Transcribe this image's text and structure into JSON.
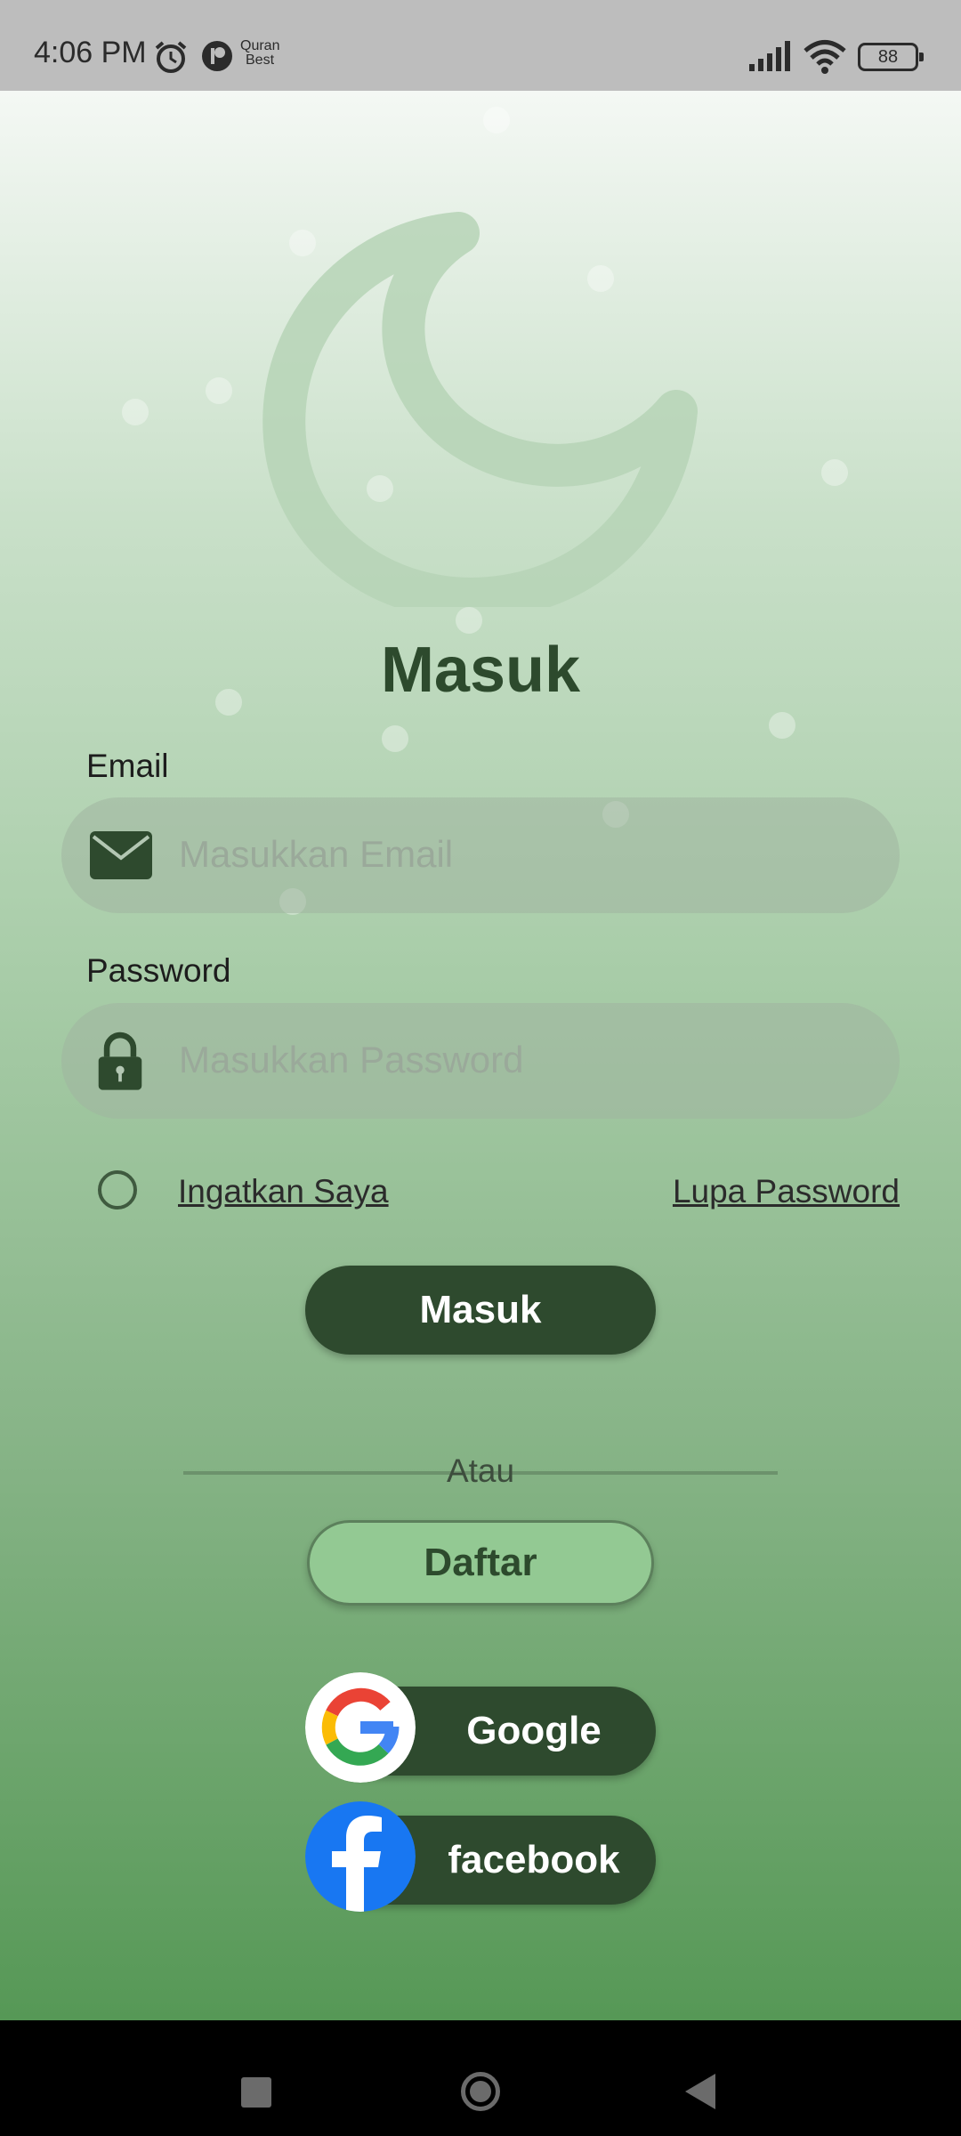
{
  "status_bar": {
    "time": "4:06 PM",
    "app_text_line1": "Quran",
    "app_text_line2": "Best",
    "battery": "88"
  },
  "login": {
    "title": "Masuk",
    "email_label": "Email",
    "email_placeholder": "Masukkan Email",
    "password_label": "Password",
    "password_placeholder": "Masukkan Password",
    "remember_label": "Ingatkan Saya",
    "forgot_label": "Lupa Password",
    "submit_label": "Masuk",
    "divider_label": "Atau",
    "register_label": "Daftar",
    "google_label": "Google",
    "facebook_label": "facebook"
  },
  "icons": {
    "email": "envelope-icon",
    "password": "lock-icon",
    "google": "google-logo-icon",
    "facebook": "facebook-logo-icon",
    "decor": "crescent-moon-icon"
  },
  "colors": {
    "primary": "#2e4a2e",
    "secondary": "#93c993",
    "facebook": "#1877f2"
  }
}
